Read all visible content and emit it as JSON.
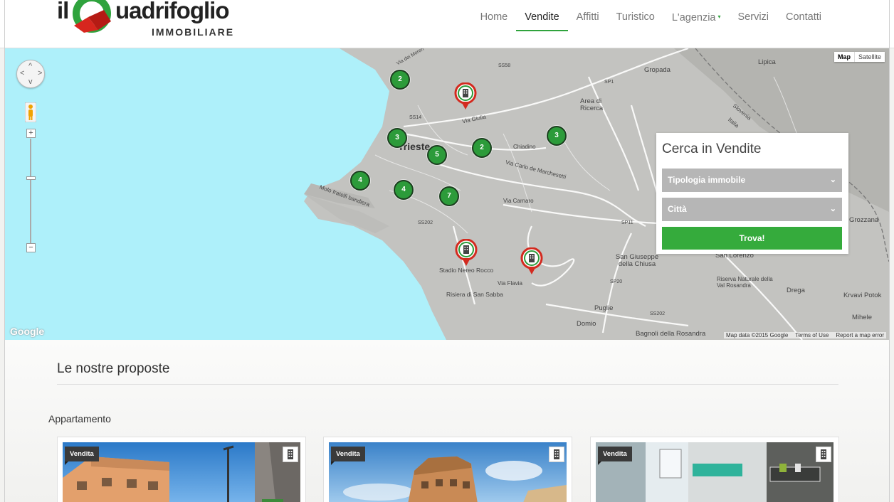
{
  "logo": {
    "il": "il",
    "rest": "uadrifoglio",
    "sub": "IMMOBILIARE"
  },
  "nav": [
    {
      "label": "Home"
    },
    {
      "label": "Vendite",
      "active": true
    },
    {
      "label": "Affitti"
    },
    {
      "label": "Turistico"
    },
    {
      "label": "L'agenzia",
      "has_dropdown": true
    },
    {
      "label": "Servizi"
    },
    {
      "label": "Contatti"
    }
  ],
  "map": {
    "type_buttons": [
      "Map",
      "Satellite"
    ],
    "google_logo": "Google",
    "footer": [
      "Map data ©2015 Google",
      "Terms of Use",
      "Report a map error"
    ],
    "labels": [
      "Trieste",
      "Gropada",
      "Lipica",
      "Area di Ricerca",
      "Grozzana",
      "San Giuseppe della Chiusa",
      "San Lorenzo",
      "Riserva Naturale della Val Rosandra",
      "Drega",
      "Krvavi Potok",
      "Mihele",
      "Puglie",
      "Domio",
      "Bagnoli della Rosandra",
      "Stadio Nereo Rocco",
      "Risiera di San Sabba",
      "Molo fratelli bandiera",
      "SS202",
      "SS14",
      "SS58",
      "SP1",
      "SP11",
      "SP20",
      "SS202",
      "Via Giulia",
      "Via Carlo de Marchesetti",
      "Via Flavia",
      "Via Carnaro",
      "Via dei Moreri",
      "Slovenia",
      "Italia",
      "Chiadino"
    ],
    "clusters": [
      "2",
      "3",
      "5",
      "2",
      "3",
      "4",
      "4",
      "7"
    ]
  },
  "search": {
    "title": "Cerca in Vendite",
    "type_placeholder": "Tipologia immobile",
    "city_placeholder": "Città",
    "submit": "Trova!"
  },
  "content": {
    "section_title": "Le nostre proposte",
    "category": "Appartamento",
    "cards": [
      {
        "badge": "Vendita"
      },
      {
        "badge": "Vendita"
      },
      {
        "badge": "Vendita"
      }
    ]
  },
  "colors": {
    "accent": "#35ab3c",
    "cluster": "#2c9b3a",
    "pin_red": "#d32a1f",
    "sea": "#aef0fa",
    "land": "#c3c3c0"
  },
  "icons": [
    "pan-control-icon",
    "pegman-icon",
    "zoom-plus-icon",
    "zoom-minus-icon",
    "chevron-down-icon",
    "building-icon",
    "map-pin-icon"
  ]
}
